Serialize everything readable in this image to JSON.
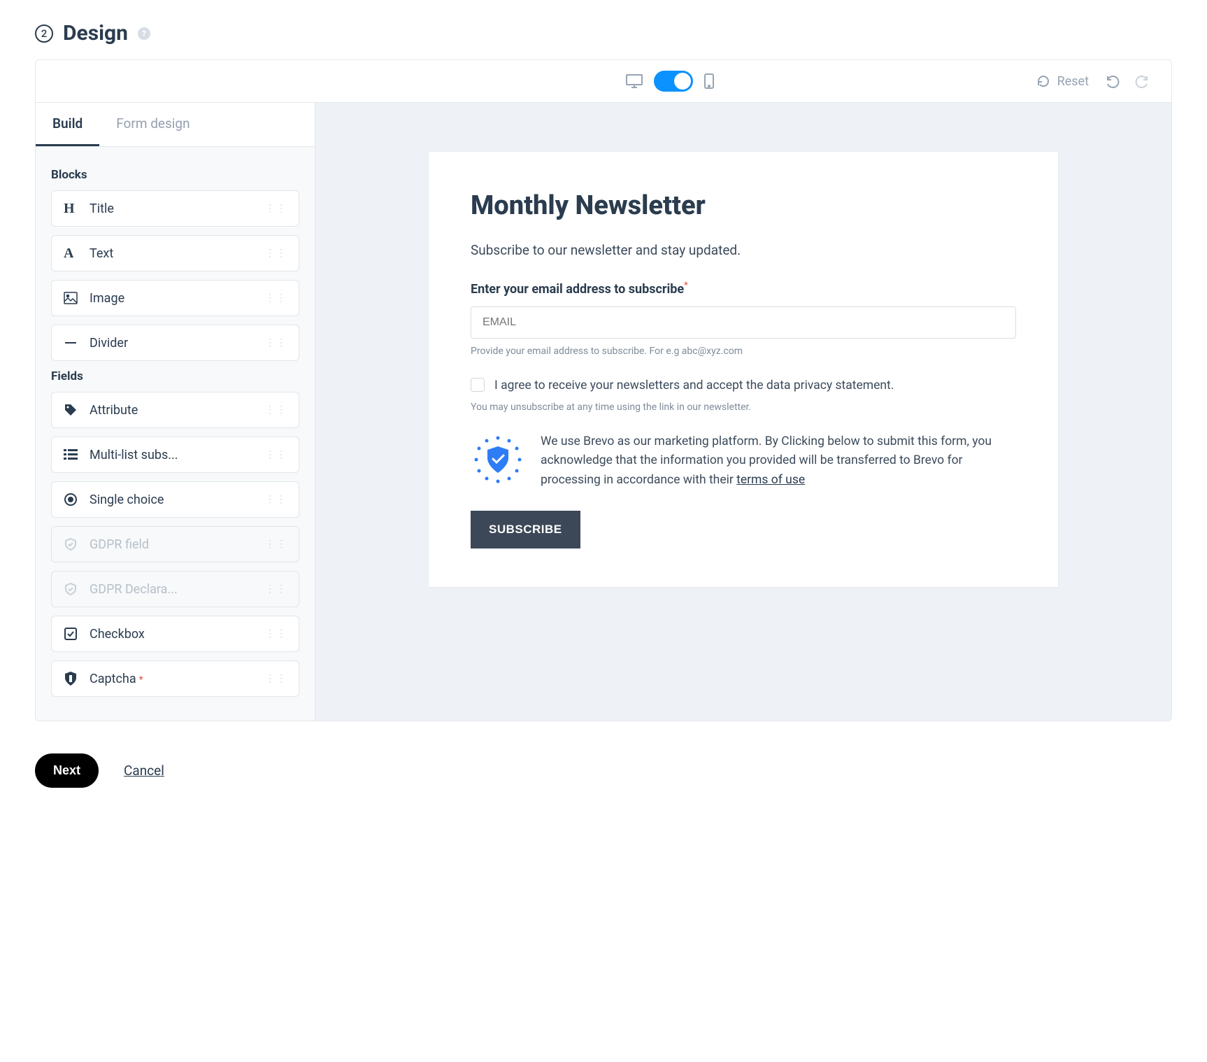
{
  "header": {
    "step": "2",
    "title": "Design"
  },
  "toolbar": {
    "reset": "Reset"
  },
  "sidebar": {
    "tabs": {
      "build": "Build",
      "formDesign": "Form design"
    },
    "groups": {
      "blocks": {
        "label": "Blocks",
        "items": [
          {
            "label": "Title"
          },
          {
            "label": "Text"
          },
          {
            "label": "Image"
          },
          {
            "label": "Divider"
          }
        ]
      },
      "fields": {
        "label": "Fields",
        "items": [
          {
            "label": "Attribute"
          },
          {
            "label": "Multi-list subs..."
          },
          {
            "label": "Single choice"
          },
          {
            "label": "GDPR field"
          },
          {
            "label": "GDPR Declara..."
          },
          {
            "label": "Checkbox"
          },
          {
            "label": "Captcha"
          }
        ]
      }
    }
  },
  "form": {
    "title": "Monthly Newsletter",
    "subtitle": "Subscribe to our newsletter and stay updated.",
    "emailLabel": "Enter your email address to subscribe",
    "emailPlaceholder": "EMAIL",
    "emailHelp": "Provide your email address to subscribe. For e.g abc@xyz.com",
    "consent": "I agree to receive your newsletters and accept the data privacy statement.",
    "consentHelp": "You may unsubscribe at any time using the link in our newsletter.",
    "gdprText": "We use Brevo as our marketing platform. By Clicking below to submit this form, you acknowledge that the information you provided will be transferred to Brevo for processing in accordance with their ",
    "gdprLink": "terms of use",
    "submit": "SUBSCRIBE"
  },
  "footer": {
    "next": "Next",
    "cancel": "Cancel"
  }
}
